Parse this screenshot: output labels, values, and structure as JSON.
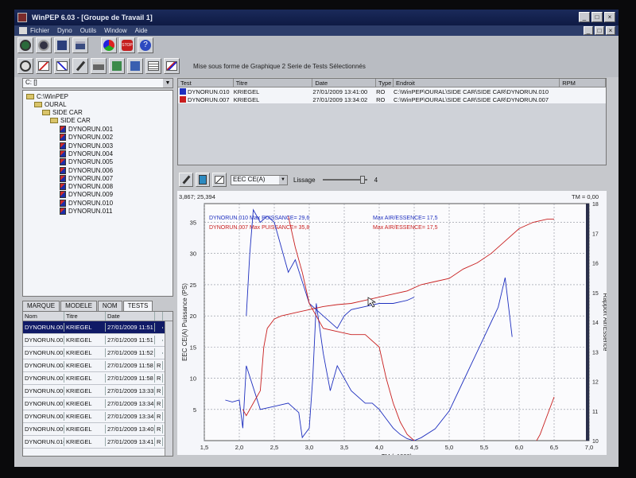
{
  "window": {
    "title": "WinPEP 6.03 - [Groupe de Travail 1]",
    "minimize": "_",
    "maximize": "□",
    "close": "×"
  },
  "menu": [
    "Fichier",
    "Dyno",
    "Outils",
    "Window",
    "Aide"
  ],
  "toolbar": {
    "row1": [
      "gauge-icon",
      "open-icon",
      "save-icon",
      "print-icon",
      "palette-icon",
      "stop-icon",
      "help-icon"
    ],
    "row2": [
      "graph-icon",
      "compare-icon",
      "chart-icon",
      "tools-icon",
      "printer-icon",
      "export-icon",
      "import-icon",
      "table-icon",
      "multi-graph-icon"
    ],
    "status": "Mise sous forme de Graphique 2 Serie de Tests Sélectionnés"
  },
  "drive": {
    "value": "C: []"
  },
  "tree": {
    "root": "C:\\WinPEP",
    "folders": [
      "OURAL",
      "SIDE CAR",
      "SIDE CAR"
    ],
    "files": [
      "DYNORUN.001",
      "DYNORUN.002",
      "DYNORUN.003",
      "DYNORUN.004",
      "DYNORUN.005",
      "DYNORUN.006",
      "DYNORUN.007",
      "DYNORUN.008",
      "DYNORUN.009",
      "DYNORUN.010",
      "DYNORUN.011"
    ]
  },
  "tabs": [
    "MARQUE",
    "MODELE",
    "NOM",
    "TESTS"
  ],
  "grid": {
    "headers": [
      "Nom",
      "Titre",
      "Date",
      ""
    ],
    "rows": [
      [
        "DYNORUN.001",
        "KRIEGEL",
        "27/01/2009 11:51",
        ""
      ],
      [
        "DYNORUN.002",
        "KRIEGEL",
        "27/01/2009 11:51",
        ""
      ],
      [
        "DYNORUN.003",
        "KRIEGEL",
        "27/01/2009 11:52",
        ""
      ],
      [
        "DYNORUN.004",
        "KRIEGEL",
        "27/01/2009 11:58",
        "R"
      ],
      [
        "DYNORUN.005",
        "KRIEGEL",
        "27/01/2009 11:58",
        "R"
      ],
      [
        "DYNORUN.006",
        "KRIEGEL",
        "27/01/2009 13:33",
        "R"
      ],
      [
        "DYNORUN.007",
        "KRIEGEL",
        "27/01/2009 13:34",
        "R"
      ],
      [
        "DYNORUN.008",
        "KRIEGEL",
        "27/01/2009 13:34",
        "R"
      ],
      [
        "DYNORUN.009",
        "KRIEGEL",
        "27/01/2009 13:40",
        "R"
      ],
      [
        "DYNORUN.010",
        "KRIEGEL",
        "27/01/2009 13:41",
        "R"
      ]
    ]
  },
  "tests": {
    "headers": [
      "Test",
      "Titre",
      "Date",
      "Type",
      "Endroit",
      "RPM"
    ],
    "rows": [
      {
        "test": "DYNORUN.010",
        "titre": "KRIEGEL",
        "date": "27/01/2009 13:41:00",
        "type": "RO",
        "endroit": "C:\\WinPEP\\OURAL\\SIDE CAR\\SIDE CAR\\DYNORUN.010",
        "rpm": "",
        "color": "#1e2fbf"
      },
      {
        "test": "DYNORUN.007",
        "titre": "KRIEGEL",
        "date": "27/01/2009 13:34:02",
        "type": "RO",
        "endroit": "C:\\WinPEP\\OURAL\\SIDE CAR\\SIDE CAR\\DYNORUN.007",
        "rpm": "",
        "color": "#c81e1e"
      }
    ]
  },
  "graph_toolbar": {
    "channel": "EEC CE(A)",
    "lissage_label": "Lissage",
    "lissage_value": "4",
    "lissage_level": 0.95
  },
  "chart_data": {
    "type": "line",
    "cursor_readout": "3,867; 25,394",
    "tm_readout": "TM = 0,00",
    "xlabel": "TM (x1000)",
    "ylabel": "EEC CE(A) Puissance (PS)",
    "y2label": "Rapport Air/Essence",
    "xlim": [
      1.5,
      7.0
    ],
    "ylim": [
      0,
      38
    ],
    "y2lim": [
      10,
      18
    ],
    "x_ticks": [
      "1,5",
      "2,0",
      "2,5",
      "3,0",
      "3,5",
      "4,0",
      "4,5",
      "5,0",
      "5,5",
      "6,0",
      "6,5",
      "7,0"
    ],
    "y_ticks": [
      "5",
      "10",
      "15",
      "20",
      "25",
      "30",
      "35"
    ],
    "y2_ticks": [
      "10",
      "11",
      "12",
      "13",
      "14",
      "15",
      "16",
      "17",
      "18"
    ],
    "annotations": [
      {
        "text": "DYNORUN.010  Max PUISSANCE= 29,6",
        "color": "#1e2fbf"
      },
      {
        "text": "DYNORUN.007  Max PUISSANCE= 35,8",
        "color": "#c81e1e"
      },
      {
        "text": "Max AIR/ESSENCE= 17,5",
        "color": "#1e2fbf"
      },
      {
        "text": "Max AIR/ESSENCE= 17,5",
        "color": "#c81e1e"
      }
    ],
    "series": [
      {
        "color": "#1e2fbf",
        "axis": "power",
        "x": [
          1.8,
          1.9,
          2.0,
          2.05,
          2.1,
          2.2,
          2.3,
          2.5,
          2.7,
          2.85,
          2.9,
          3.0,
          3.05,
          3.1,
          3.2,
          3.3,
          3.4,
          3.6,
          3.8,
          3.9,
          4.0,
          4.1,
          4.2,
          4.3,
          4.4,
          4.5
        ],
        "y": [
          6.5,
          6.2,
          6.5,
          2.0,
          12.0,
          8.5,
          5.0,
          5.5,
          6.0,
          4.5,
          0.5,
          2.0,
          10.0,
          22.0,
          14.0,
          8.0,
          12.0,
          8.0,
          6.0,
          6.0,
          5.0,
          3.5,
          2.0,
          1.0,
          0.3,
          0.0
        ]
      },
      {
        "color": "#1e2fbf",
        "axis": "power",
        "x": [
          2.1,
          2.15,
          2.2,
          2.3,
          2.4,
          2.5,
          2.6,
          2.7,
          2.8,
          3.0,
          3.2,
          3.4,
          3.5,
          3.6,
          3.8,
          4.0,
          4.2,
          4.4,
          4.5
        ],
        "y": [
          20.0,
          30.0,
          37.0,
          35.0,
          36.0,
          35.0,
          31.0,
          27.0,
          29.0,
          22.0,
          20.0,
          18.0,
          20.0,
          21.0,
          21.5,
          22.0,
          22.0,
          22.5,
          23.0
        ]
      },
      {
        "color": "#1e2fbf",
        "axis": "afr",
        "x": [
          4.5,
          4.6,
          4.8,
          5.0,
          5.2,
          5.4,
          5.6,
          5.7,
          5.75,
          5.8,
          5.85,
          5.9
        ],
        "y": [
          10.0,
          10.1,
          10.4,
          11.0,
          12.0,
          13.0,
          14.0,
          14.5,
          15.0,
          15.5,
          14.5,
          13.5
        ]
      },
      {
        "color": "#c81e1e",
        "axis": "power",
        "x": [
          2.05,
          2.1,
          2.2,
          2.3,
          2.35,
          2.4,
          2.5,
          2.6,
          2.8,
          3.0,
          3.2,
          3.4,
          3.6,
          3.8,
          4.0,
          4.2,
          4.4,
          4.6,
          4.8,
          5.0,
          5.2,
          5.4,
          5.6,
          5.8,
          6.0,
          6.2,
          6.4,
          6.5
        ],
        "y": [
          5.0,
          4.0,
          6.0,
          8.0,
          15.0,
          18.0,
          19.5,
          20.0,
          20.5,
          21.0,
          21.5,
          21.8,
          22.0,
          22.5,
          23.0,
          23.5,
          24.0,
          25.0,
          25.5,
          26.0,
          27.5,
          28.5,
          30.0,
          32.0,
          34.0,
          35.0,
          35.5,
          35.5
        ]
      },
      {
        "color": "#c81e1e",
        "axis": "power",
        "x": [
          2.7,
          2.8,
          2.9,
          3.0,
          3.1,
          3.2,
          3.4,
          3.6,
          3.8,
          4.0,
          4.1,
          4.2,
          4.3,
          4.4,
          4.5
        ],
        "y": [
          36.0,
          31.0,
          27.0,
          22.0,
          20.0,
          18.0,
          17.5,
          17.0,
          17.0,
          15.0,
          10.0,
          6.0,
          3.0,
          1.0,
          0.0
        ]
      },
      {
        "color": "#c81e1e",
        "axis": "power",
        "x": [
          6.25,
          6.3,
          6.4,
          6.5
        ],
        "y": [
          0.0,
          1.0,
          4.0,
          7.0
        ]
      }
    ]
  }
}
